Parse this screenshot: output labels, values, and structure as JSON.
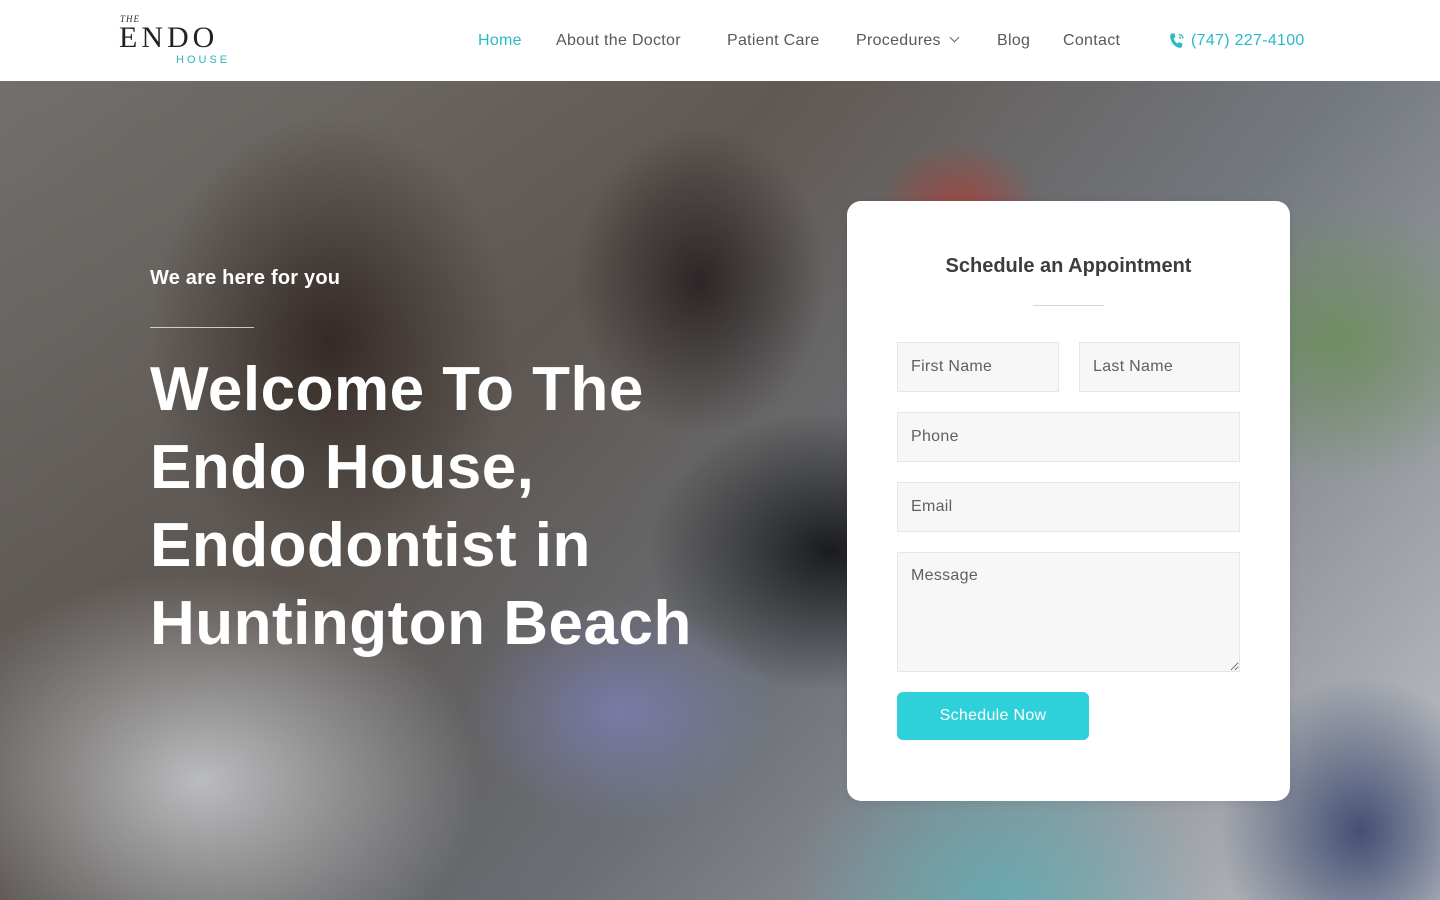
{
  "logo": {
    "the": "THE",
    "endo": "ENDO",
    "house": "HOUSE"
  },
  "nav": {
    "items": [
      {
        "label": "Home",
        "active": true
      },
      {
        "label": "About the Doctor",
        "active": false
      },
      {
        "label": "Patient Care",
        "active": false
      },
      {
        "label": "Procedures",
        "active": false,
        "has_dropdown": true
      },
      {
        "label": "Blog",
        "active": false
      },
      {
        "label": "Contact",
        "active": false
      }
    ],
    "phone": "(747) 227-4100"
  },
  "hero": {
    "tagline": "We are here for you",
    "title": "Welcome To The Endo House, Endodontist in Huntington Beach"
  },
  "form": {
    "title": "Schedule an Appointment",
    "first_name_placeholder": "First Name",
    "last_name_placeholder": "Last Name",
    "phone_placeholder": "Phone",
    "email_placeholder": "Email",
    "message_placeholder": "Message",
    "submit_label": "Schedule Now"
  },
  "colors": {
    "accent": "#2ab9c7",
    "button": "#2ed1d9",
    "nav_text": "#555a5e",
    "heading": "#3d3d3d"
  },
  "icons": {
    "phone": "phone-ringing-icon",
    "dropdown": "chevron-down-icon"
  }
}
